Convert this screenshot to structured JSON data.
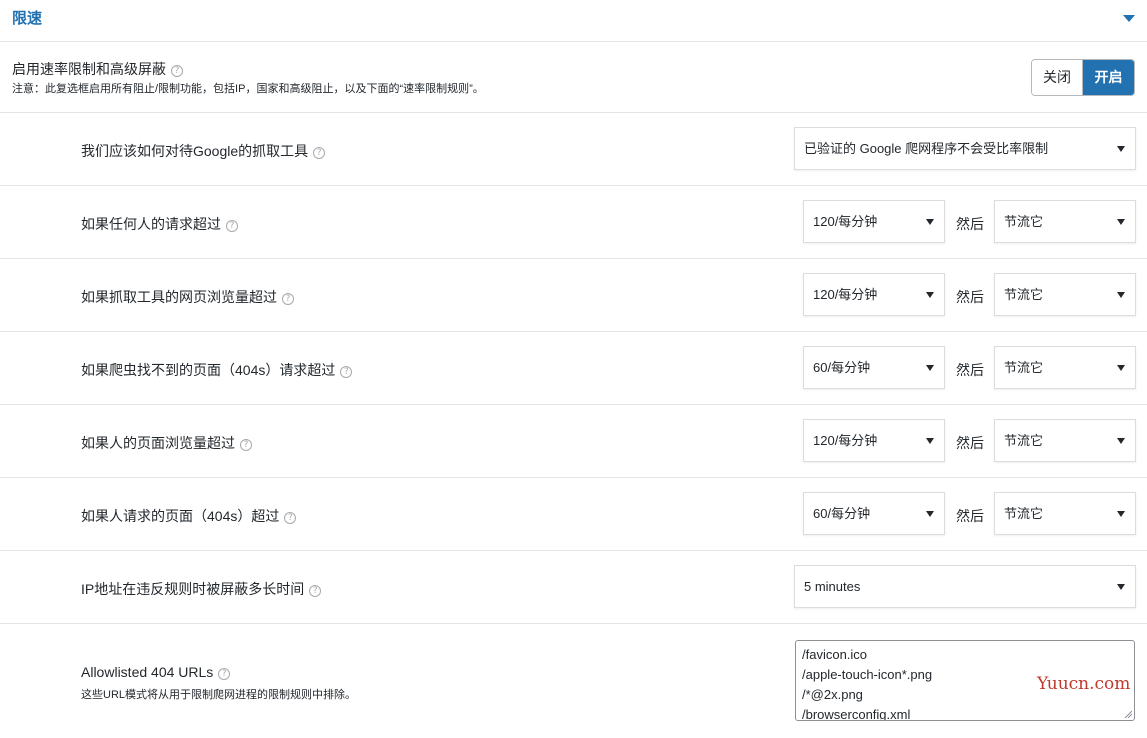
{
  "section": {
    "title": "限速",
    "collapse_icon": "triangle-down-icon"
  },
  "master": {
    "label": "启用速率限制和高级屏蔽",
    "note": "注意：此复选框启用所有阻止/限制功能，包括IP，国家和高级阻止，以及下面的“速率限制规则”。",
    "toggle_off": "关闭",
    "toggle_on": "开启",
    "toggle_state": "on",
    "accent_color": "#2271b1"
  },
  "google_row": {
    "label": "我们应该如何对待Google的抓取工具",
    "select_value": "已验证的 Google 爬网程序不会受比率限制"
  },
  "then_label": "然后",
  "rules": [
    {
      "label": "如果任何人的请求超过",
      "rate": "120/每分钟",
      "action": "节流它"
    },
    {
      "label": "如果抓取工具的网页浏览量超过",
      "rate": "120/每分钟",
      "action": "节流它"
    },
    {
      "label": "如果爬虫找不到的页面（404s）请求超过",
      "rate": "60/每分钟",
      "action": "节流它"
    },
    {
      "label": "如果人的页面浏览量超过",
      "rate": "120/每分钟",
      "action": "节流它"
    },
    {
      "label": "如果人请求的页面（404s）超过",
      "rate": "60/每分钟",
      "action": "节流它"
    }
  ],
  "block_duration": {
    "label": "IP地址在违反规则时被屏蔽多长时间",
    "select_value": "5 minutes"
  },
  "allowlist": {
    "label": "Allowlisted 404 URLs",
    "description": "这些URL模式将从用于限制爬网进程的限制规则中排除。",
    "lines": [
      "/favicon.ico",
      "/apple-touch-icon*.png",
      "/*@2x.png",
      "/browserconfig.xml"
    ]
  },
  "watermark": "Yuucn.com"
}
